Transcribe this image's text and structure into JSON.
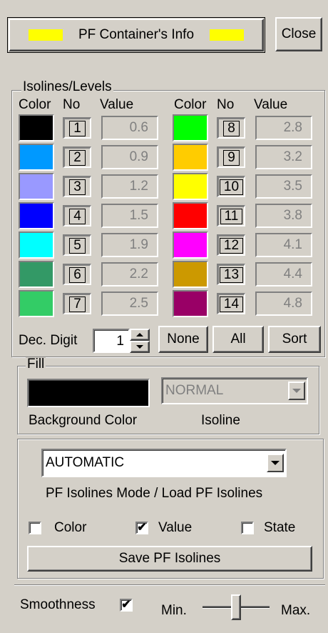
{
  "header": {
    "info_button": "PF Container's Info",
    "info_swatch_color": "#ffff00",
    "close_button": "Close"
  },
  "levels": {
    "title": "Isolines/Levels",
    "col_color": "Color",
    "col_no": "No",
    "col_value": "Value",
    "items": [
      {
        "no": "1",
        "value": "0.6",
        "color": "#000000"
      },
      {
        "no": "2",
        "value": "0.9",
        "color": "#0099ff"
      },
      {
        "no": "3",
        "value": "1.2",
        "color": "#9999ff"
      },
      {
        "no": "4",
        "value": "1.5",
        "color": "#0000ff"
      },
      {
        "no": "5",
        "value": "1.9",
        "color": "#00ffff"
      },
      {
        "no": "6",
        "value": "2.2",
        "color": "#339966"
      },
      {
        "no": "7",
        "value": "2.5",
        "color": "#33cc66"
      },
      {
        "no": "8",
        "value": "2.8",
        "color": "#00ff00"
      },
      {
        "no": "9",
        "value": "3.2",
        "color": "#ffcc00"
      },
      {
        "no": "10",
        "value": "3.5",
        "color": "#ffff00"
      },
      {
        "no": "11",
        "value": "3.8",
        "color": "#ff0000"
      },
      {
        "no": "12",
        "value": "4.1",
        "color": "#ff00ff"
      },
      {
        "no": "13",
        "value": "4.4",
        "color": "#cc9900"
      },
      {
        "no": "14",
        "value": "4.8",
        "color": "#990066"
      }
    ],
    "dec_digit_label": "Dec. Digit",
    "dec_digit_value": "1",
    "none_button": "None",
    "all_button": "All",
    "sort_button": "Sort"
  },
  "fill": {
    "title": "Fill",
    "background_color": "#000000",
    "background_color_label": "Background Color",
    "isoline_select": "NORMAL",
    "isoline_label": "Isoline"
  },
  "mode": {
    "select_value": "AUTOMATIC",
    "caption": "PF Isolines Mode / Load PF Isolines",
    "color_checkbox": {
      "label": "Color",
      "checked": false
    },
    "value_checkbox": {
      "label": "Value",
      "checked": true
    },
    "state_checkbox": {
      "label": "State",
      "checked": false
    },
    "save_button": "Save PF Isolines"
  },
  "smoothness": {
    "label": "Smoothness",
    "checked": true,
    "min_label": "Min.",
    "max_label": "Max.",
    "level": 0.5
  }
}
